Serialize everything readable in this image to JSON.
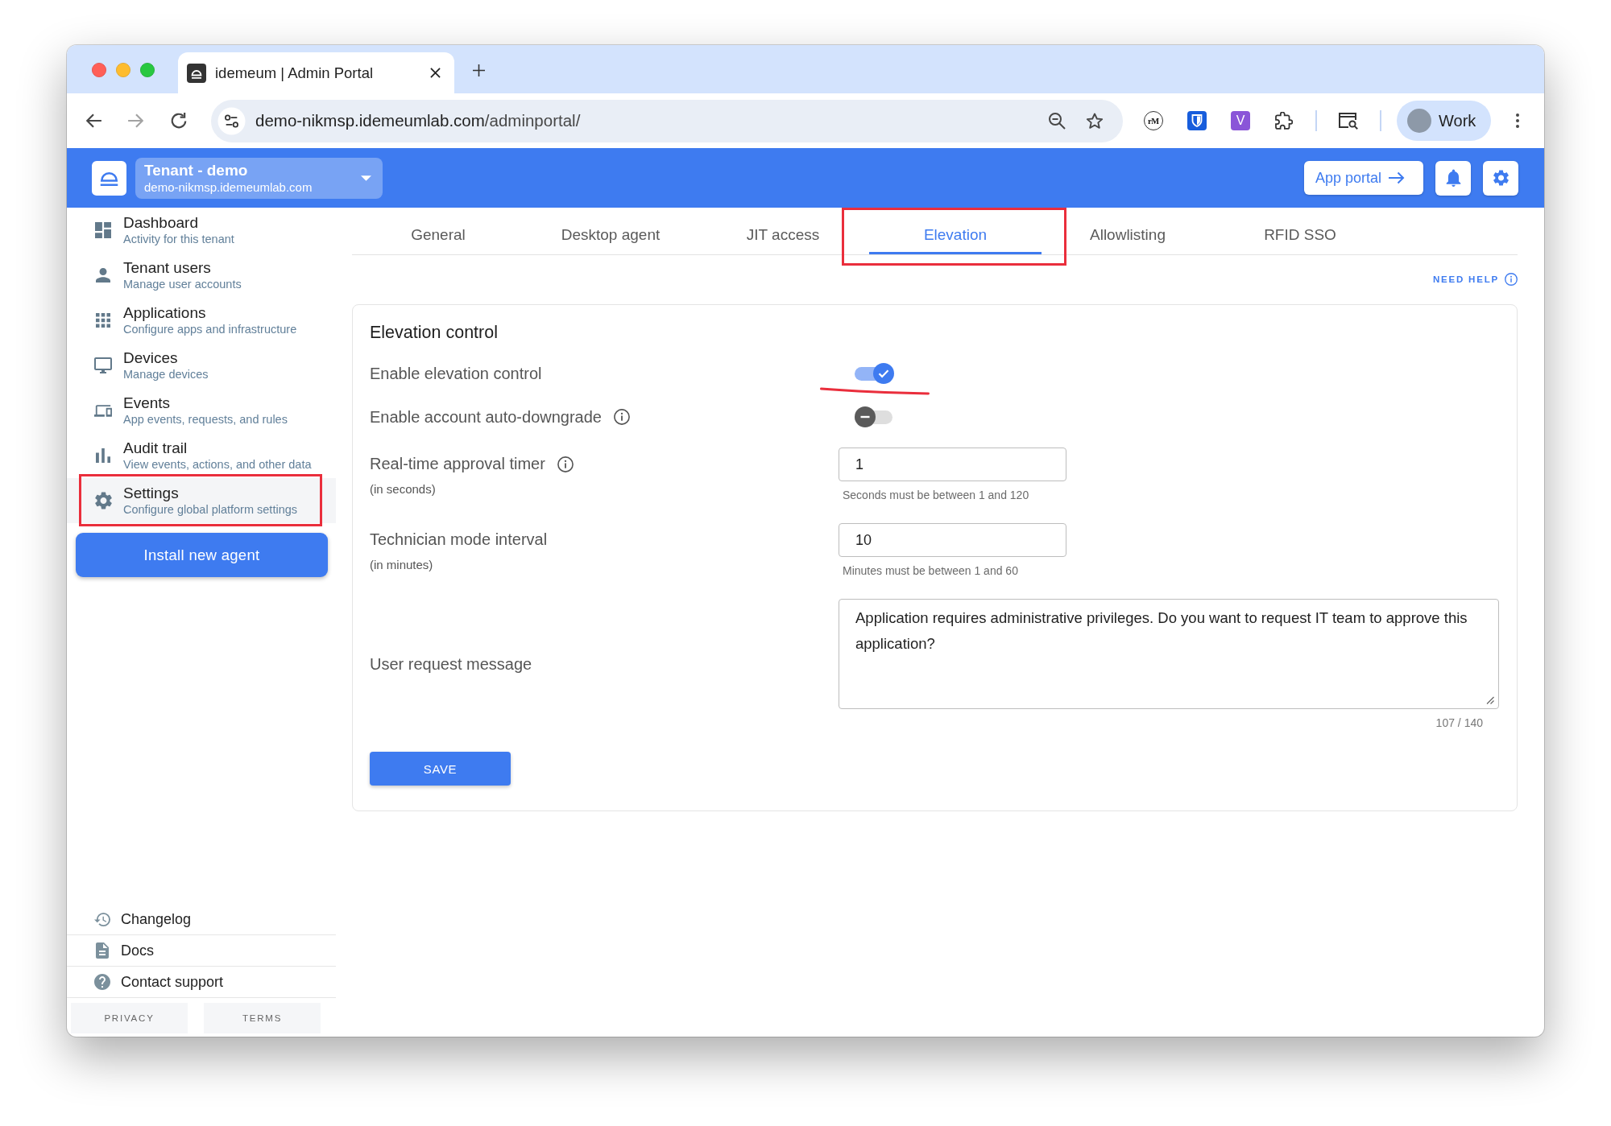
{
  "browser": {
    "tab_title": "idemeum | Admin Portal",
    "url": {
      "host": "demo-nikmsp.idemeumlab.com",
      "path": "/adminportal/"
    },
    "extension_monograms": [
      "rM",
      "V"
    ],
    "profile": "Work"
  },
  "header": {
    "tenant": {
      "name": "Tenant - demo",
      "domain": "demo-nikmsp.idemeumlab.com"
    },
    "app_portal_button": "App portal"
  },
  "sidebar": {
    "items": [
      {
        "title": "Dashboard",
        "subtitle": "Activity for this tenant",
        "selected": false,
        "annotated": false
      },
      {
        "title": "Tenant users",
        "subtitle": "Manage user accounts",
        "selected": false,
        "annotated": false
      },
      {
        "title": "Applications",
        "subtitle": "Configure apps and infrastructure",
        "selected": false,
        "annotated": false
      },
      {
        "title": "Devices",
        "subtitle": "Manage devices",
        "selected": false,
        "annotated": false
      },
      {
        "title": "Events",
        "subtitle": "App events, requests, and rules",
        "selected": false,
        "annotated": false
      },
      {
        "title": "Audit trail",
        "subtitle": "View events, actions, and other data",
        "selected": false,
        "annotated": false
      },
      {
        "title": "Settings",
        "subtitle": "Configure global platform settings",
        "selected": true,
        "annotated": true
      }
    ],
    "install_button": "Install new agent",
    "links": [
      "Changelog",
      "Docs",
      "Contact support"
    ],
    "legal_links": [
      "PRIVACY",
      "TERMS"
    ]
  },
  "tabs": [
    {
      "label": "General",
      "selected": false,
      "annotated": false
    },
    {
      "label": "Desktop agent",
      "selected": false,
      "annotated": false
    },
    {
      "label": "JIT access",
      "selected": false,
      "annotated": false
    },
    {
      "label": "Elevation",
      "selected": true,
      "annotated": true
    },
    {
      "label": "Allowlisting",
      "selected": false,
      "annotated": false
    },
    {
      "label": "RFID SSO",
      "selected": false,
      "annotated": false
    }
  ],
  "help_link": "NEED HELP",
  "card": {
    "title": "Elevation control",
    "settings": [
      {
        "kind": "toggle",
        "label": "Enable elevation control",
        "info": false,
        "on": true,
        "annotated": true
      },
      {
        "kind": "toggle",
        "label": "Enable account auto-downgrade",
        "info": true,
        "on": false,
        "annotated": false
      },
      {
        "kind": "number",
        "label": "Real-time approval timer",
        "info": true,
        "unit": "(in seconds)",
        "value": "1",
        "hint": "Seconds must be between 1 and 120"
      },
      {
        "kind": "number",
        "label": "Technician mode interval",
        "info": false,
        "unit": "(in minutes)",
        "value": "10",
        "hint": "Minutes must be between 1 and 60"
      },
      {
        "kind": "textarea",
        "label": "User request message",
        "value": "Application requires administrative privileges. Do you want to request IT team to approve this application?",
        "counter": "107 / 140"
      }
    ],
    "save_button": "SAVE"
  }
}
